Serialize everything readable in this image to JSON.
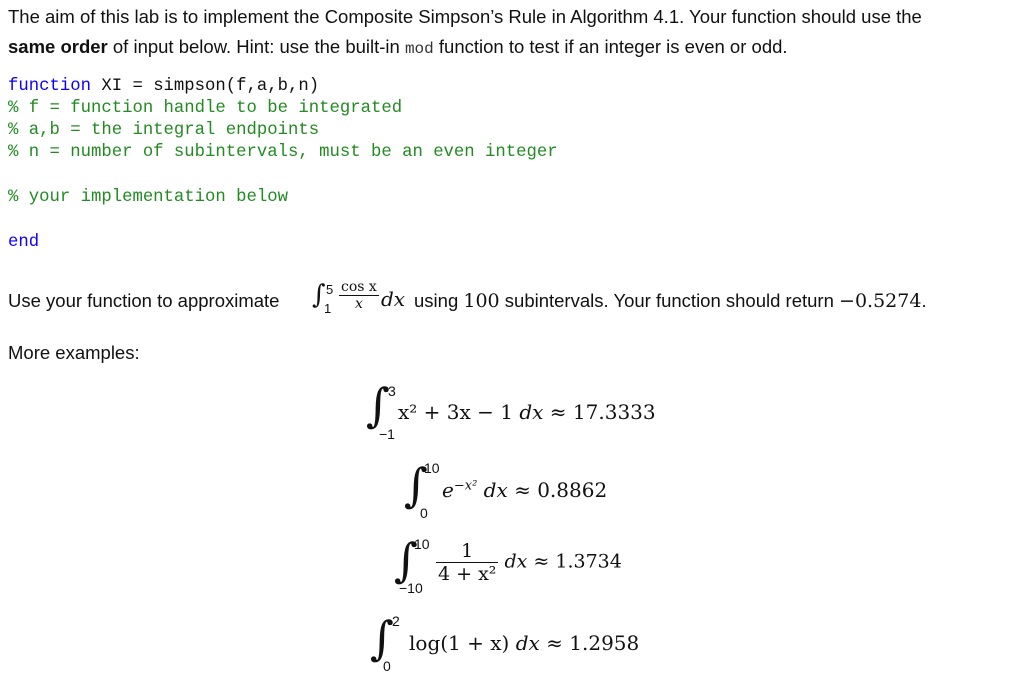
{
  "intro": {
    "line1": "The aim of this lab is to implement the Composite Simpson’s Rule in Algorithm 4.1. Your function should use the",
    "line2_bold": "same order",
    "line2_pre_mono": " of input below. Hint: use the built-in ",
    "line2_mono": "mod",
    "line2_post_mono": " function to test if an integer is even or odd."
  },
  "code": {
    "line1_keyword": "function",
    "line1_rest": " XI = simpson(f,a,b,n)",
    "comment1": "% f = function handle to be integrated",
    "comment2": "% a,b = the integral endpoints",
    "comment3": "% n = number of subintervals, must be an even integer",
    "comment4": "% your implementation below",
    "end_keyword": "end"
  },
  "task": {
    "prefix": "Use your function to approximate ",
    "integral": {
      "lower": "1",
      "upper": "5",
      "numerator": "cos x",
      "denominator": "x",
      "differential": "dx"
    },
    "middle_number": "100",
    "middle_text": " subintervals. Your function should return ",
    "using_text": "using ",
    "expected_value": "−0.5274",
    "suffix": "."
  },
  "examples": {
    "heading": "More examples:",
    "items": [
      {
        "lower": "−1",
        "upper": "3",
        "integrand": "x² + 3x − 1",
        "differential": "dx",
        "approx": "≈ 17.3333"
      },
      {
        "lower": "0",
        "upper": "10",
        "integrand_base": "e",
        "integrand_exp": "−x²",
        "differential": "dx",
        "approx": "≈ 0.8862"
      },
      {
        "lower": "−10",
        "upper": "10",
        "numerator": "1",
        "denominator": "4 + x²",
        "differential": "dx",
        "approx": "≈ 1.3734"
      },
      {
        "lower": "0",
        "upper": "2",
        "integrand": "log(1 + x)",
        "differential": "dx",
        "approx": "≈ 1.2958"
      }
    ]
  }
}
